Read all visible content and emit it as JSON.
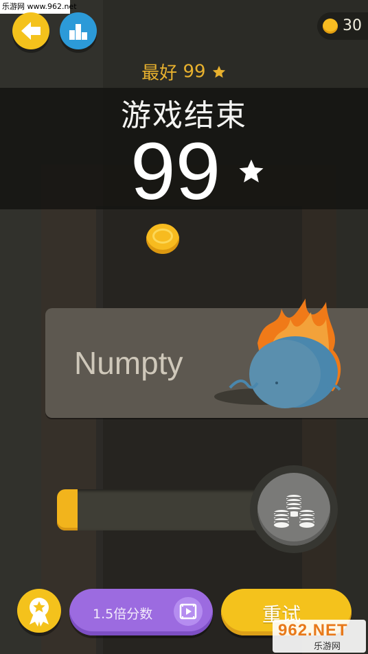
{
  "watermark_top": "乐游网 www.962.net",
  "header": {
    "back_icon": "arrow-left-icon",
    "leaderboard_icon": "bar-chart-icon",
    "coin_count": "30"
  },
  "best": {
    "label": "最好",
    "value": "99"
  },
  "result": {
    "title": "游戏结束",
    "score": "99"
  },
  "character": {
    "name": "Numpty"
  },
  "progress": {
    "fill_fraction": 0.09,
    "icon": "coin-stack-icon"
  },
  "bottom_bar": {
    "badge_icon": "ribbon-star-icon",
    "double_score_label": "1.5倍分数",
    "video_icon": "film-play-icon",
    "retry_label": "重试"
  },
  "watermark_br": {
    "brand": "962.NET",
    "site": "乐游网"
  },
  "colors": {
    "background": "#2b2b26",
    "accent_yellow": "#f4c21c",
    "accent_purple": "#9c6be0",
    "accent_blue": "#2c9ad8",
    "best_text": "#e8b12e"
  }
}
